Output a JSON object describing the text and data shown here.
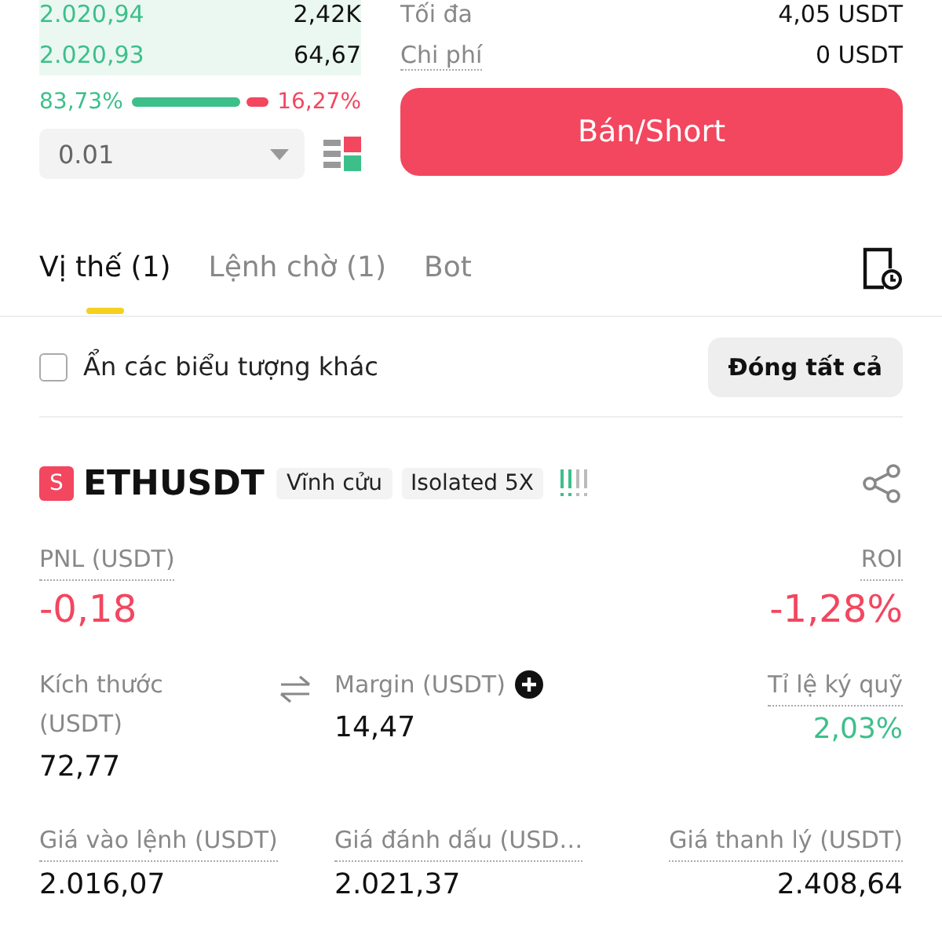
{
  "order_book": {
    "rows": [
      {
        "price": "2.020,94",
        "amount": "2,42K"
      },
      {
        "price": "2.020,93",
        "amount": "64,67"
      }
    ],
    "buy_percent": "83,73%",
    "sell_percent": "16,27%",
    "precision": "0.01"
  },
  "order_info": [
    {
      "label": "Tối đa",
      "value": "4,05 USDT",
      "kind": "plain"
    },
    {
      "label": "Chi phí",
      "value": "0 USDT",
      "kind": "hint"
    }
  ],
  "short_button": "Bán/Short",
  "tabs": [
    {
      "label": "Vị thế (1)",
      "selected": true
    },
    {
      "label": "Lệnh chờ (1)",
      "selected": false
    },
    {
      "label": "Bot",
      "selected": false
    }
  ],
  "hide_other_symbols": {
    "label": "Ẩn các biểu tượng khác",
    "checked": false
  },
  "close_all_button": "Đóng tất cả",
  "position": {
    "side_badge": "S",
    "symbol": "ETHUSDT",
    "tags": [
      "Vĩnh cửu",
      "Isolated 5X"
    ],
    "pnl": {
      "label": "PNL (USDT)",
      "value": "-0,18",
      "color": "#f2475f"
    },
    "roi": {
      "label": "ROI",
      "value": "-1,28%",
      "color": "#f2475f"
    },
    "fields": [
      {
        "label": "Kích thước (USDT)",
        "value": "72,77",
        "color": "#111111",
        "kind": "swap"
      },
      {
        "label": "Margin (USDT)",
        "value": "14,47",
        "color": "#111111",
        "kind": "add"
      },
      {
        "label": "Tỉ lệ ký quỹ",
        "value": "2,03%",
        "color": "#3dbf8a",
        "kind": "plain"
      },
      {
        "label": "Giá vào lệnh (USDT)",
        "value": "2.016,07",
        "color": "#111111",
        "kind": "plain"
      },
      {
        "label": "Giá đánh dấu (USD…",
        "value": "2.021,37",
        "color": "#111111",
        "kind": "plain"
      },
      {
        "label": "Giá thanh lý (USDT)",
        "value": "2.408,64",
        "color": "#111111",
        "kind": "plain"
      }
    ]
  }
}
